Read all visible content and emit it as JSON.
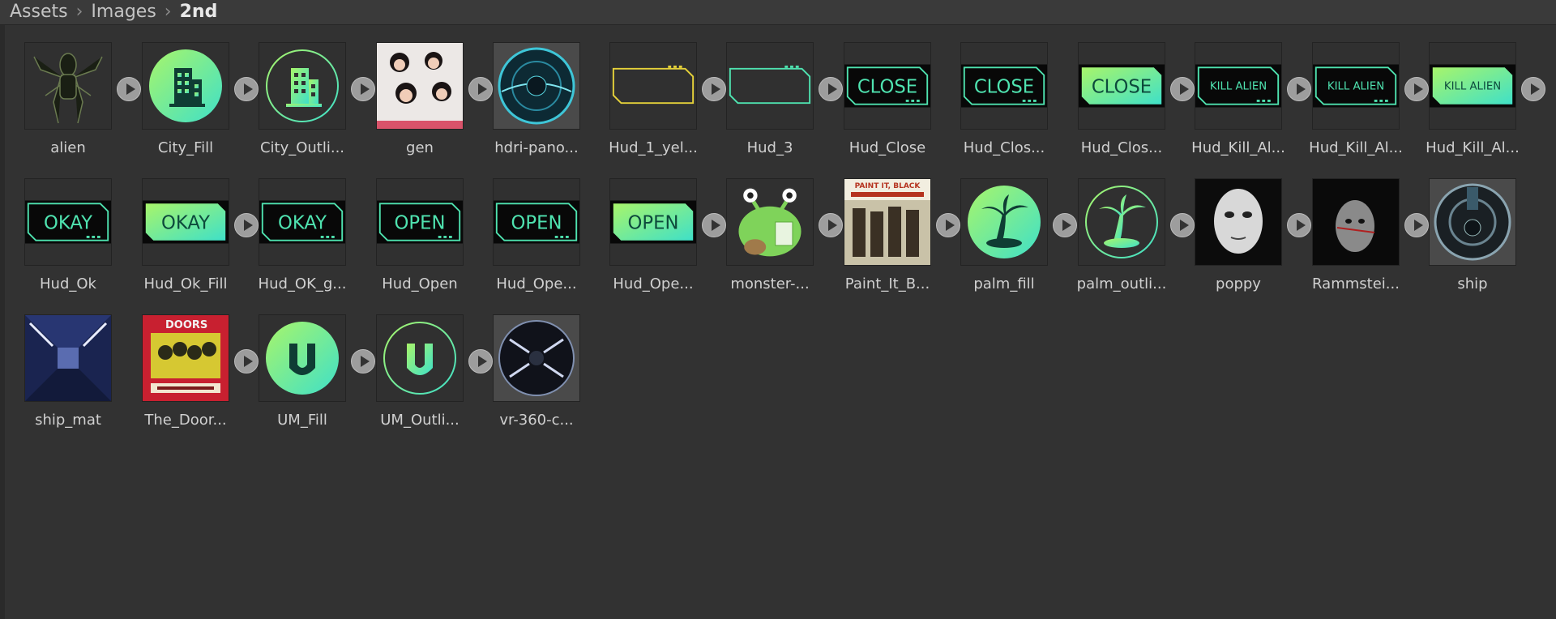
{
  "breadcrumb": {
    "items": [
      "Assets",
      "Images",
      "2nd"
    ]
  },
  "assets": [
    {
      "label": "alien",
      "thumb": "alien"
    },
    {
      "label": "City_Fill",
      "thumb": "city-fill"
    },
    {
      "label": "City_Outli...",
      "thumb": "city-outline"
    },
    {
      "label": "gen",
      "thumb": "photo-group"
    },
    {
      "label": "hdri-pano...",
      "thumb": "sphere-teal"
    },
    {
      "label": "Hud_1_yel...",
      "thumb": "hud-yellow"
    },
    {
      "label": "Hud_3",
      "thumb": "hud-teal"
    },
    {
      "label": "Hud_Close",
      "text": "CLOSE",
      "thumb": "hud-text-outline"
    },
    {
      "label": "Hud_Clos...",
      "text": "CLOSE",
      "thumb": "hud-text-outline"
    },
    {
      "label": "Hud_Clos...",
      "text": "CLOSE",
      "thumb": "hud-text-fill"
    },
    {
      "label": "Hud_Kill_Al...",
      "text": "KILL ALIEN",
      "thumb": "hud-text-outline-small"
    },
    {
      "label": "Hud_Kill_Al...",
      "text": "KILL ALIEN",
      "thumb": "hud-text-outline-small"
    },
    {
      "label": "Hud_Kill_Al...",
      "text": "KILL ALIEN",
      "thumb": "hud-text-fill-small"
    },
    {
      "label": "Hud_Ok",
      "text": "OKAY",
      "thumb": "hud-text-outline"
    },
    {
      "label": "Hud_Ok_Fill",
      "text": "OKAY",
      "thumb": "hud-text-fill"
    },
    {
      "label": "Hud_OK_g...",
      "text": "OKAY",
      "thumb": "hud-text-outline"
    },
    {
      "label": "Hud_Open",
      "text": "OPEN",
      "thumb": "hud-text-outline"
    },
    {
      "label": "Hud_Ope...",
      "text": "OPEN",
      "thumb": "hud-text-outline"
    },
    {
      "label": "Hud_Ope...",
      "text": "OPEN",
      "thumb": "hud-text-fill"
    },
    {
      "label": "monster-...",
      "thumb": "monster"
    },
    {
      "label": "Paint_It_B...",
      "text": "PAINT IT, BLACK",
      "thumb": "album-photo"
    },
    {
      "label": "palm_fill",
      "thumb": "palm-fill"
    },
    {
      "label": "palm_outli...",
      "thumb": "palm-outline"
    },
    {
      "label": "poppy",
      "thumb": "face-white"
    },
    {
      "label": "Rammstei...",
      "thumb": "face-dark"
    },
    {
      "label": "ship",
      "thumb": "sphere-steel"
    },
    {
      "label": "ship_mat",
      "thumb": "corridor"
    },
    {
      "label": "The_Door...",
      "text": "DOORS",
      "thumb": "album-red"
    },
    {
      "label": "UM_Fill",
      "thumb": "um-fill"
    },
    {
      "label": "UM_Outli...",
      "thumb": "um-outline"
    },
    {
      "label": "vr-360-c...",
      "thumb": "sphere-tunnel"
    }
  ],
  "colors": {
    "teal": "#4fe3b0",
    "yellow": "#e6d23a",
    "background": "#323232"
  }
}
